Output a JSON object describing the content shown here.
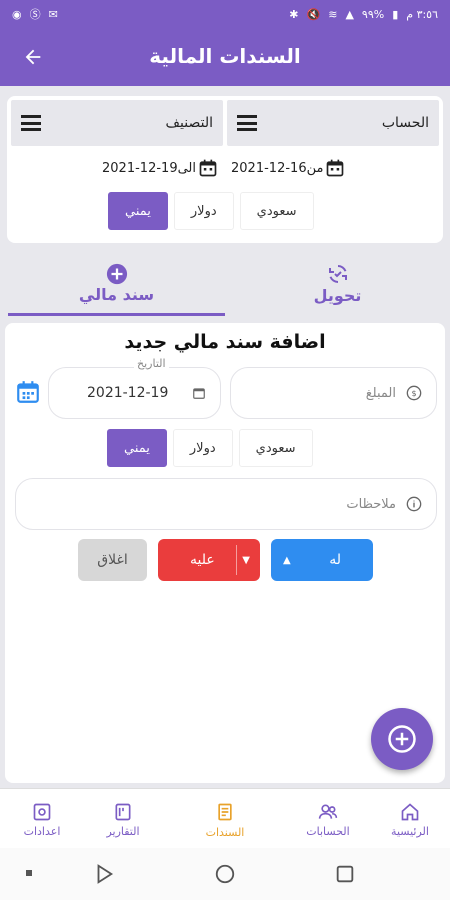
{
  "status_bar": {
    "time": "٣:٥٦ م",
    "battery": "٩٩%"
  },
  "app_bar": {
    "title": "السندات المالية"
  },
  "filters": {
    "account_label": "الحساب",
    "category_label": "التصنيف",
    "date_from": "من16-12-2021",
    "date_to": "الى19-12-2021",
    "currencies": [
      "سعودي",
      "دولار",
      "يمني"
    ],
    "active_currency": "يمني"
  },
  "tabs": [
    {
      "label": "تحويل",
      "icon": "transfer-icon"
    },
    {
      "label": "سند مالي",
      "icon": "add-circle-icon"
    }
  ],
  "form": {
    "title": "اضافة سند مالي جديد",
    "amount_placeholder": "المبلغ",
    "date_label": "التاريخ",
    "date_value": "2021-12-19",
    "currencies": [
      "سعودي",
      "دولار",
      "يمني"
    ],
    "notes_placeholder": "ملاحظات",
    "credit_label": "له",
    "debit_label": "عليه",
    "close_label": "اغلاق"
  },
  "bottom_nav": [
    {
      "label": "الرئيسية",
      "icon": "home-icon"
    },
    {
      "label": "الحسابات",
      "icon": "users-icon"
    },
    {
      "label": "السندات",
      "icon": "voucher-icon"
    },
    {
      "label": "التقارير",
      "icon": "report-icon"
    },
    {
      "label": "اعدادات",
      "icon": "settings-icon"
    }
  ],
  "colors": {
    "primary": "#7b5cc4",
    "credit": "#2f8df0",
    "debit": "#ea3d3d",
    "close": "#d7d7d7",
    "active_nav": "#e8a22b"
  }
}
